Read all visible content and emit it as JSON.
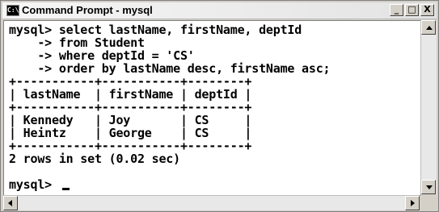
{
  "window": {
    "title": "Command Prompt - mysql",
    "icon_label": "C:\\",
    "minimize": "_",
    "maximize": "□",
    "close": "X"
  },
  "console": {
    "lines": [
      "mysql> select lastName, firstName, deptId",
      "    -> from Student",
      "    -> where deptId = 'CS'",
      "    -> order by lastName desc, firstName asc;",
      "+-----------+-----------+--------+",
      "| lastName  | firstName | deptId |",
      "+-----------+-----------+--------+",
      "| Kennedy   | Joy       | CS     |",
      "| Heintz    | George    | CS     |",
      "+-----------+-----------+--------+",
      "2 rows in set (0.02 sec)",
      "",
      "mysql> "
    ]
  },
  "icons": {
    "app": "command-prompt-icon",
    "scroll_up": "up-arrow-icon",
    "scroll_down": "down-arrow-icon",
    "scroll_left": "left-arrow-icon",
    "scroll_right": "right-arrow-icon"
  }
}
